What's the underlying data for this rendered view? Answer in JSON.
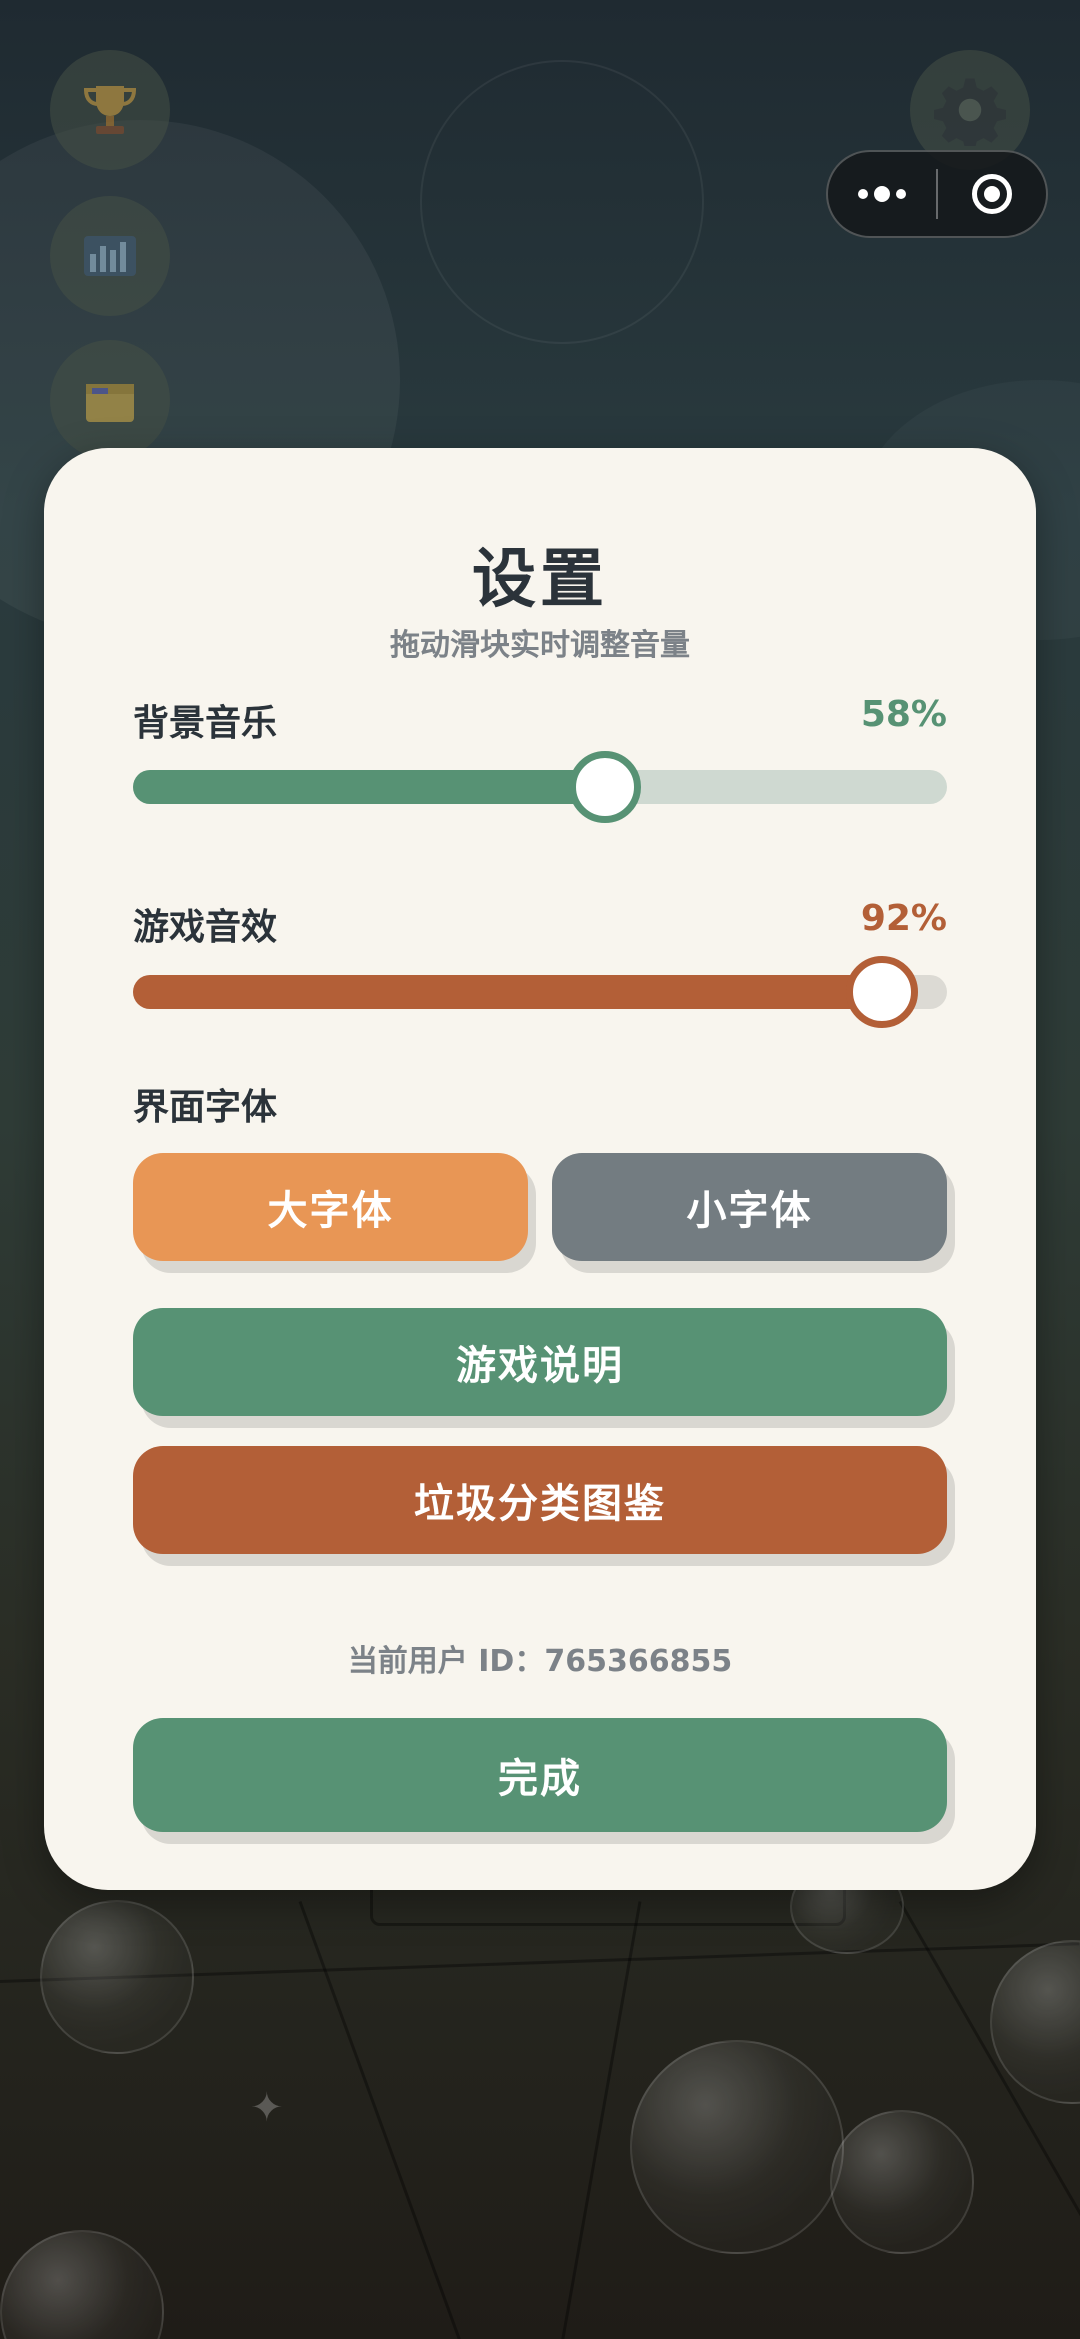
{
  "colors": {
    "green": "#579274",
    "green_track": "#cfd9d1",
    "rust": "#b35f37",
    "rust_track": "#dcdad4",
    "orange": "#e89655",
    "gray": "#737c81",
    "title": "#2b333a",
    "muted": "#7c8288"
  },
  "capsule": {
    "more_icon": "more-dots-icon",
    "close_icon": "target-close-icon"
  },
  "side_icons": [
    "trophy-icon",
    "chart-icon",
    "box-icon"
  ],
  "settings_icon": "gear-icon",
  "dialog": {
    "title": "设置",
    "subtitle": "拖动滑块实时调整音量",
    "music": {
      "label": "背景音乐",
      "value_text": "58%",
      "value": 0.58
    },
    "sfx": {
      "label": "游戏音效",
      "value_text": "92%",
      "value": 0.92
    },
    "font": {
      "label": "界面字体",
      "large": "大字体",
      "small": "小字体",
      "selected": "large"
    },
    "guide_button": "游戏说明",
    "catalog_button": "垃圾分类图鉴",
    "user_id": "当前用户 ID：765366855",
    "done_button": "完成"
  }
}
